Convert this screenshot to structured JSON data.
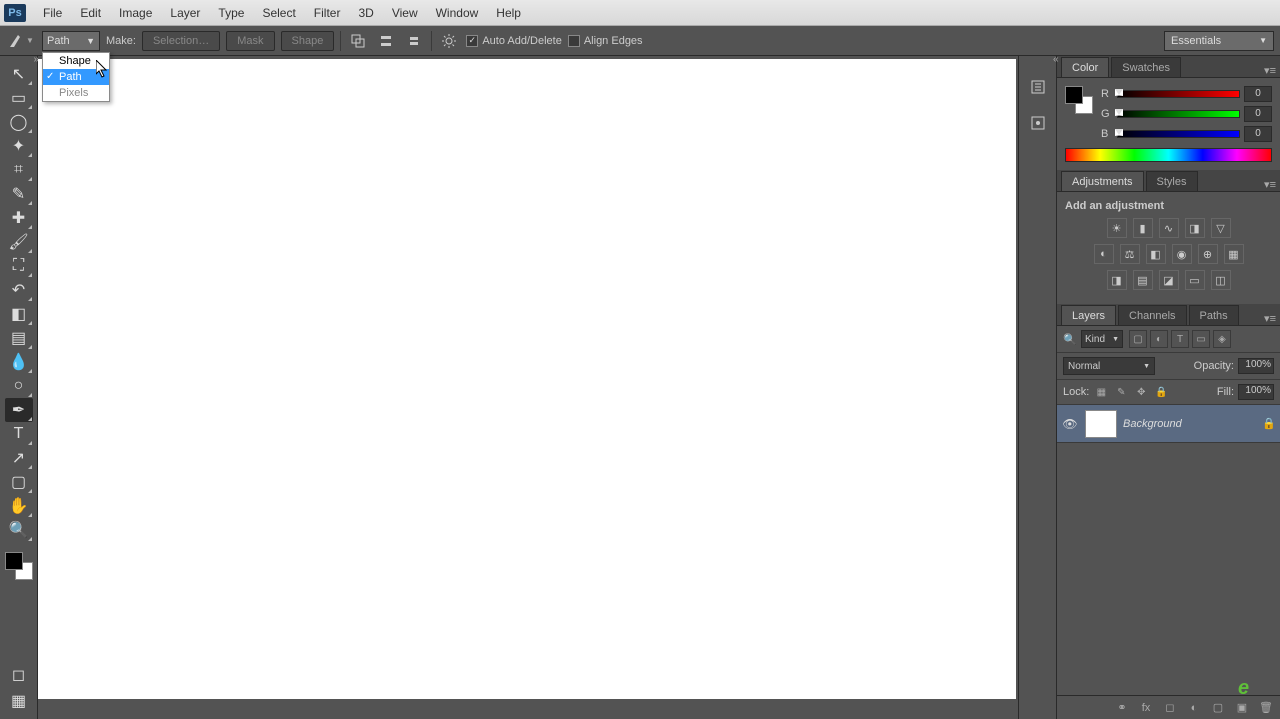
{
  "menubar": [
    "File",
    "Edit",
    "Image",
    "Layer",
    "Type",
    "Select",
    "Filter",
    "3D",
    "View",
    "Window",
    "Help"
  ],
  "ps_logo": "Ps",
  "optionsbar": {
    "mode_value": "Path",
    "mode_options": [
      {
        "label": "Shape",
        "selected": false
      },
      {
        "label": "Path",
        "selected": true
      },
      {
        "label": "Pixels",
        "selected": false,
        "disabled": true
      }
    ],
    "make_label": "Make:",
    "selection_btn": "Selection…",
    "mask_btn": "Mask",
    "shape_btn": "Shape",
    "auto_add_delete": "Auto Add/Delete",
    "align_edges": "Align Edges",
    "workspace": "Essentials"
  },
  "tools": [
    {
      "name": "move-tool",
      "glyph": "↖"
    },
    {
      "name": "marquee-tool",
      "glyph": "▭"
    },
    {
      "name": "lasso-tool",
      "glyph": "◯"
    },
    {
      "name": "magic-wand-tool",
      "glyph": "✦"
    },
    {
      "name": "crop-tool",
      "glyph": "⌗"
    },
    {
      "name": "eyedropper-tool",
      "glyph": "✎"
    },
    {
      "name": "healing-brush-tool",
      "glyph": "✚"
    },
    {
      "name": "brush-tool",
      "glyph": "🖌"
    },
    {
      "name": "clone-stamp-tool",
      "glyph": "⛶"
    },
    {
      "name": "history-brush-tool",
      "glyph": "↶"
    },
    {
      "name": "eraser-tool",
      "glyph": "◧"
    },
    {
      "name": "gradient-tool",
      "glyph": "▤"
    },
    {
      "name": "blur-tool",
      "glyph": "💧"
    },
    {
      "name": "dodge-tool",
      "glyph": "○"
    },
    {
      "name": "pen-tool",
      "glyph": "✒",
      "active": true
    },
    {
      "name": "type-tool",
      "glyph": "T"
    },
    {
      "name": "path-selection-tool",
      "glyph": "↗"
    },
    {
      "name": "rectangle-tool",
      "glyph": "▢"
    },
    {
      "name": "hand-tool",
      "glyph": "✋"
    },
    {
      "name": "zoom-tool",
      "glyph": "🔍"
    }
  ],
  "panels": {
    "color_tab": "Color",
    "swatches_tab": "Swatches",
    "rgb": {
      "r": "0",
      "g": "0",
      "b": "0"
    },
    "adjustments_tab": "Adjustments",
    "styles_tab": "Styles",
    "add_adjustment": "Add an adjustment",
    "layers_tab": "Layers",
    "channels_tab": "Channels",
    "paths_tab": "Paths",
    "kind": "Kind",
    "blend_mode": "Normal",
    "opacity_label": "Opacity:",
    "opacity_val": "100%",
    "lock_label": "Lock:",
    "fill_label": "Fill:",
    "fill_val": "100%",
    "layer_name": "Background"
  }
}
